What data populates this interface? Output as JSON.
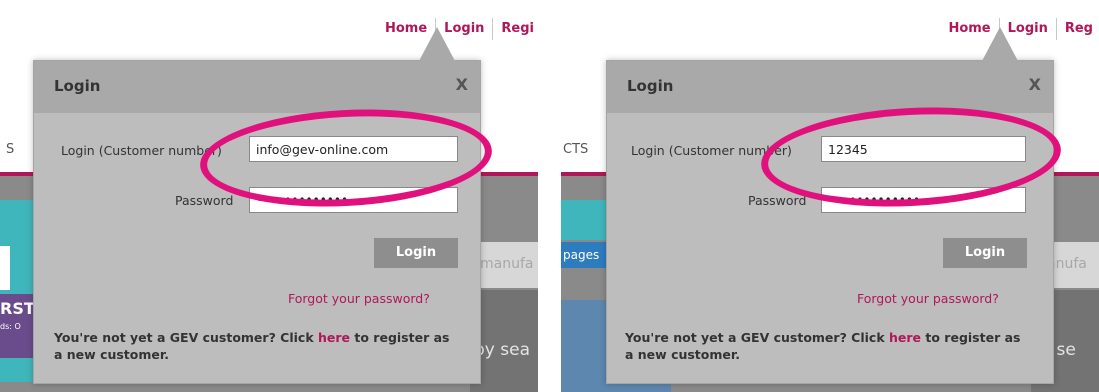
{
  "left": {
    "nav": {
      "home": "Home",
      "login": "Login",
      "register_partial": "Regi"
    },
    "menu_fragment": "S",
    "search_fragment": "manufa",
    "by_search_fragment": "by sea",
    "promo_fragment": "RST",
    "promo_small_fragment": "ds: O",
    "popup": {
      "title": "Login",
      "close": "X",
      "customer_label": "Login (Customer number)",
      "customer_value": "info@gev-online.com",
      "password_label": "Password",
      "password_value": "•••••••••••••",
      "login_button": "Login",
      "forgot_link": "Forgot your password?",
      "register_text_1": "You're not yet a GEV customer? Click ",
      "register_link": "here",
      "register_text_2": " to register as a new customer."
    }
  },
  "right": {
    "nav": {
      "home": "Home",
      "login": "Login",
      "register_partial": "Reg"
    },
    "menu_fragment": "CTS",
    "pages_fragment": "pages",
    "search_fragment": "anufa",
    "by_search_fragment": "y se",
    "popup": {
      "title": "Login",
      "close": "X",
      "customer_label": "Login (Customer number)",
      "customer_value": "12345",
      "password_label": "Password",
      "password_value": "•••••••••••••",
      "login_button": "Login",
      "forgot_link": "Forgot your password?",
      "register_text_1": "You're not yet a GEV customer? Click ",
      "register_link": "here",
      "register_text_2": " to register as a new customer."
    }
  },
  "colors": {
    "brand": "#b0175a",
    "highlight": "#e0117c",
    "popup_bg": "#bdbdbd"
  }
}
